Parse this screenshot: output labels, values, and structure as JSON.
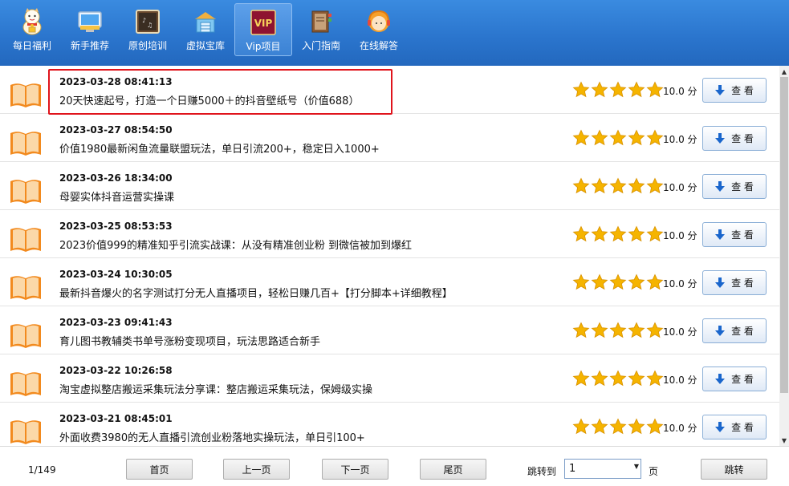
{
  "toolbar": {
    "items": [
      {
        "label": "每日福利",
        "icon": "lucky-cat-icon",
        "active": false
      },
      {
        "label": "新手推荐",
        "icon": "monitor-icon",
        "active": false
      },
      {
        "label": "原创培训",
        "icon": "chalkboard-icon",
        "active": false
      },
      {
        "label": "虚拟宝库",
        "icon": "warehouse-icon",
        "active": false
      },
      {
        "label": "Vip项目",
        "icon": "vip-icon",
        "active": true
      },
      {
        "label": "入门指南",
        "icon": "guide-book-icon",
        "active": false
      },
      {
        "label": "在线解答",
        "icon": "support-agent-icon",
        "active": false
      }
    ],
    "vip_badge": "VIP"
  },
  "list": {
    "rows": [
      {
        "date": "2023-03-28 08:41:13",
        "title": "20天快速起号，打造一个日赚5000＋的抖音壁纸号（价值688）",
        "rating": 5,
        "score": "10.0 分",
        "button": "查 看"
      },
      {
        "date": "2023-03-27 08:54:50",
        "title": "价值1980最新闲鱼流量联盟玩法，单日引流200+，稳定日入1000+",
        "rating": 5,
        "score": "10.0 分",
        "button": "查 看"
      },
      {
        "date": "2023-03-26 18:34:00",
        "title": "母婴实体抖音运营实操课",
        "rating": 5,
        "score": "10.0 分",
        "button": "查 看"
      },
      {
        "date": "2023-03-25 08:53:53",
        "title": "2023价值999的精准知乎引流实战课：从没有精准创业粉 到微信被加到爆红",
        "rating": 5,
        "score": "10.0 分",
        "button": "查 看"
      },
      {
        "date": "2023-03-24 10:30:05",
        "title": "最新抖音爆火的名字测试打分无人直播项目，轻松日赚几百+【打分脚本+详细教程】",
        "rating": 5,
        "score": "10.0 分",
        "button": "查 看"
      },
      {
        "date": "2023-03-23 09:41:43",
        "title": "育儿图书教辅类书单号涨粉变现项目，玩法思路适合新手",
        "rating": 5,
        "score": "10.0 分",
        "button": "查 看"
      },
      {
        "date": "2023-03-22 10:26:58",
        "title": "淘宝虚拟整店搬运采集玩法分享课：整店搬运采集玩法，保姆级实操",
        "rating": 5,
        "score": "10.0 分",
        "button": "查 看"
      },
      {
        "date": "2023-03-21 08:45:01",
        "title": "外面收费3980的无人直播引流创业粉落地实操玩法，单日引100+",
        "rating": 5,
        "score": "10.0 分",
        "button": "查 看"
      }
    ]
  },
  "footer": {
    "page_info": "1/149",
    "first": "首页",
    "prev": "上一页",
    "next": "下一页",
    "last": "尾页",
    "jump_label": "跳转到",
    "page_value": "1",
    "page_unit": "页",
    "jump_button": "跳转"
  },
  "colors": {
    "toolbar": "#2a74cc",
    "highlight": "#e0141c",
    "star": "#f5b400",
    "button_arrow": "#1a66cc"
  }
}
